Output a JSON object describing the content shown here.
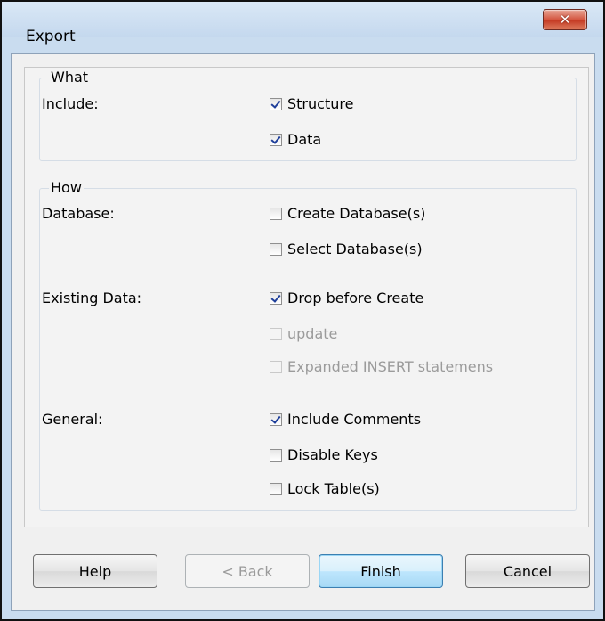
{
  "window": {
    "title": "Export",
    "close_glyph": "✕"
  },
  "what": {
    "legend": "What",
    "include_label": "Include:",
    "options": [
      {
        "label": "Structure",
        "checked": true,
        "enabled": true
      },
      {
        "label": "Data",
        "checked": true,
        "enabled": true
      }
    ]
  },
  "how": {
    "legend": "How",
    "database": {
      "label": "Database:",
      "options": [
        {
          "label": "Create Database(s)",
          "checked": false,
          "enabled": true
        },
        {
          "label": "Select Database(s)",
          "checked": false,
          "enabled": true
        }
      ]
    },
    "existing_data": {
      "label": "Existing Data:",
      "options": [
        {
          "label": "Drop before Create",
          "checked": true,
          "enabled": true
        },
        {
          "label": "update",
          "checked": false,
          "enabled": false
        },
        {
          "label": "Expanded INSERT statemens",
          "checked": false,
          "enabled": false
        }
      ]
    },
    "general": {
      "label": "General:",
      "options": [
        {
          "label": "Include Comments",
          "checked": true,
          "enabled": true
        },
        {
          "label": "Disable Keys",
          "checked": false,
          "enabled": true
        },
        {
          "label": "Lock Table(s)",
          "checked": false,
          "enabled": true
        }
      ]
    }
  },
  "buttons": {
    "help": "Help",
    "back": "< Back",
    "finish": "Finish",
    "cancel": "Cancel"
  },
  "colors": {
    "window_frame": "#c9dcef",
    "close_button": "#c2351f",
    "primary_button_border": "#3c7fb1",
    "check_mark": "#1f3f9a"
  },
  "icons": {
    "close": "close-icon",
    "checkbox": "checkbox-icon"
  }
}
